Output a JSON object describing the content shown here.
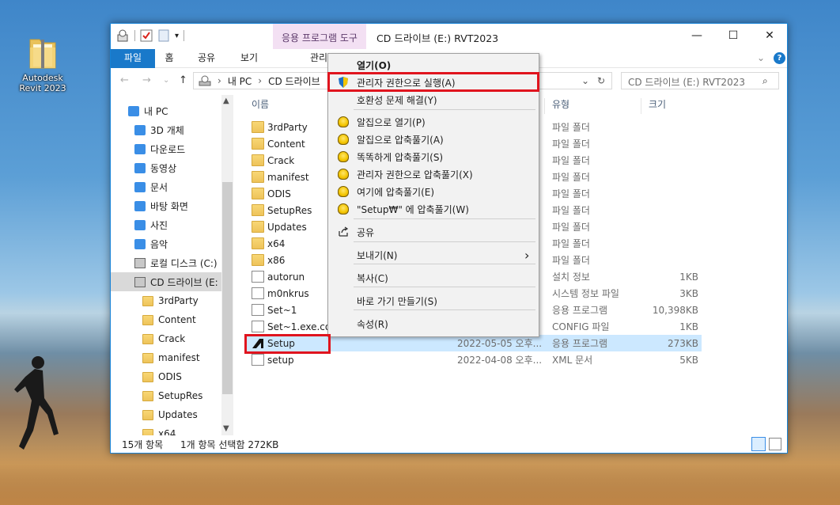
{
  "desktop": {
    "icon_label_1": "Autodesk",
    "icon_label_2": "Revit 2023"
  },
  "window": {
    "tool_tab": "응용 프로그램 도구",
    "title": "CD 드라이브 (E:) RVT2023",
    "minimize": "—",
    "maximize": "☐",
    "close": "✕"
  },
  "ribbon": {
    "tabs": [
      "파일",
      "홈",
      "공유",
      "보기",
      "관리"
    ],
    "expand": "⌄",
    "help": "?"
  },
  "address": {
    "path": [
      "내 PC",
      "CD 드라이브"
    ],
    "search_placeholder": "CD 드라이브 (E:) RVT2023"
  },
  "nav": {
    "items": [
      {
        "label": "내 PC",
        "icon": "pc-icon"
      },
      {
        "label": "3D 개체",
        "icon": "cube-icon"
      },
      {
        "label": "다운로드",
        "icon": "download-icon"
      },
      {
        "label": "동영상",
        "icon": "video-icon"
      },
      {
        "label": "문서",
        "icon": "document-icon"
      },
      {
        "label": "바탕 화면",
        "icon": "desktop-icon"
      },
      {
        "label": "사진",
        "icon": "picture-icon"
      },
      {
        "label": "음악",
        "icon": "music-icon"
      },
      {
        "label": "로컬 디스크 (C:)",
        "icon": "disk-icon"
      },
      {
        "label": "CD 드라이브 (E:",
        "icon": "cd-drive-icon"
      },
      {
        "label": "3rdParty",
        "icon": "folder-icon"
      },
      {
        "label": "Content",
        "icon": "folder-icon"
      },
      {
        "label": "Crack",
        "icon": "folder-icon"
      },
      {
        "label": "manifest",
        "icon": "folder-icon"
      },
      {
        "label": "ODIS",
        "icon": "folder-icon"
      },
      {
        "label": "SetupRes",
        "icon": "folder-icon"
      },
      {
        "label": "Updates",
        "icon": "folder-icon"
      },
      {
        "label": "x64",
        "icon": "folder-icon"
      }
    ]
  },
  "columns": {
    "name": "이름",
    "type": "유형",
    "size": "크기"
  },
  "files": [
    {
      "name": "3rdParty",
      "date": "",
      "type": "파일 폴더",
      "size": "",
      "icon": "folder-icon"
    },
    {
      "name": "Content",
      "date": "",
      "type": "파일 폴더",
      "size": "",
      "icon": "folder-icon"
    },
    {
      "name": "Crack",
      "date": "",
      "type": "파일 폴더",
      "size": "",
      "icon": "folder-icon"
    },
    {
      "name": "manifest",
      "date": "",
      "type": "파일 폴더",
      "size": "",
      "icon": "folder-icon"
    },
    {
      "name": "ODIS",
      "date": "",
      "type": "파일 폴더",
      "size": "",
      "icon": "folder-icon"
    },
    {
      "name": "SetupRes",
      "date": "",
      "type": "파일 폴더",
      "size": "",
      "icon": "folder-icon"
    },
    {
      "name": "Updates",
      "date": "",
      "type": "파일 폴더",
      "size": "",
      "icon": "folder-icon"
    },
    {
      "name": "x64",
      "date": "",
      "type": "파일 폴더",
      "size": "",
      "icon": "folder-icon"
    },
    {
      "name": "x86",
      "date": "",
      "type": "파일 폴더",
      "size": "",
      "icon": "folder-icon"
    },
    {
      "name": "autorun",
      "date": "",
      "type": "설치 정보",
      "size": "1KB",
      "icon": "setup-info-icon"
    },
    {
      "name": "m0nkrus",
      "date": "",
      "type": "시스템 정보 파일",
      "size": "3KB",
      "icon": "system-info-icon"
    },
    {
      "name": "Set~1",
      "date": "",
      "type": "응용 프로그램",
      "size": "10,398KB",
      "icon": "app-icon"
    },
    {
      "name": "Set~1.exe.con",
      "date": "",
      "type": "CONFIG 파일",
      "size": "1KB",
      "icon": "file-icon"
    },
    {
      "name": "Setup",
      "date": "2022-05-05 오후...",
      "type": "응용 프로그램",
      "size": "273KB",
      "icon": "autodesk-icon"
    },
    {
      "name": "setup",
      "date": "2022-04-08 오후...",
      "type": "XML 문서",
      "size": "5KB",
      "icon": "xml-icon"
    }
  ],
  "status": {
    "count": "15개 항목",
    "selected": "1개 항목 선택함 272KB"
  },
  "context_menu": {
    "items": [
      {
        "label": "열기(O)",
        "icon": ""
      },
      {
        "label": "관리자 권한으로 실행(A)",
        "icon": "shield-icon"
      },
      {
        "label": "호환성 문제 해결(Y)",
        "icon": ""
      },
      {
        "label": "알집으로 열기(P)",
        "icon": "alzip-icon"
      },
      {
        "label": "알집으로 압축풀기(A)",
        "icon": "alzip-icon"
      },
      {
        "label": "똑똑하게 압축풀기(S)",
        "icon": "alzip-icon"
      },
      {
        "label": "관리자 권한으로 압축풀기(X)",
        "icon": "alzip-shield-icon"
      },
      {
        "label": "여기에 압축풀기(E)",
        "icon": "alzip-icon"
      },
      {
        "label": "\"Setup₩\" 에 압축풀기(W)",
        "icon": "alzip-icon"
      },
      {
        "label": "공유",
        "icon": "share-icon"
      },
      {
        "label": "보내기(N)",
        "icon": ""
      },
      {
        "label": "복사(C)",
        "icon": ""
      },
      {
        "label": "바로 가기 만들기(S)",
        "icon": ""
      },
      {
        "label": "속성(R)",
        "icon": ""
      }
    ],
    "submenu_arrow": "›"
  },
  "colors": {
    "accent": "#1979ca",
    "highlight": "#e0141e",
    "selected_row": "#cce8ff",
    "tool_tab": "#f3e0f3"
  }
}
